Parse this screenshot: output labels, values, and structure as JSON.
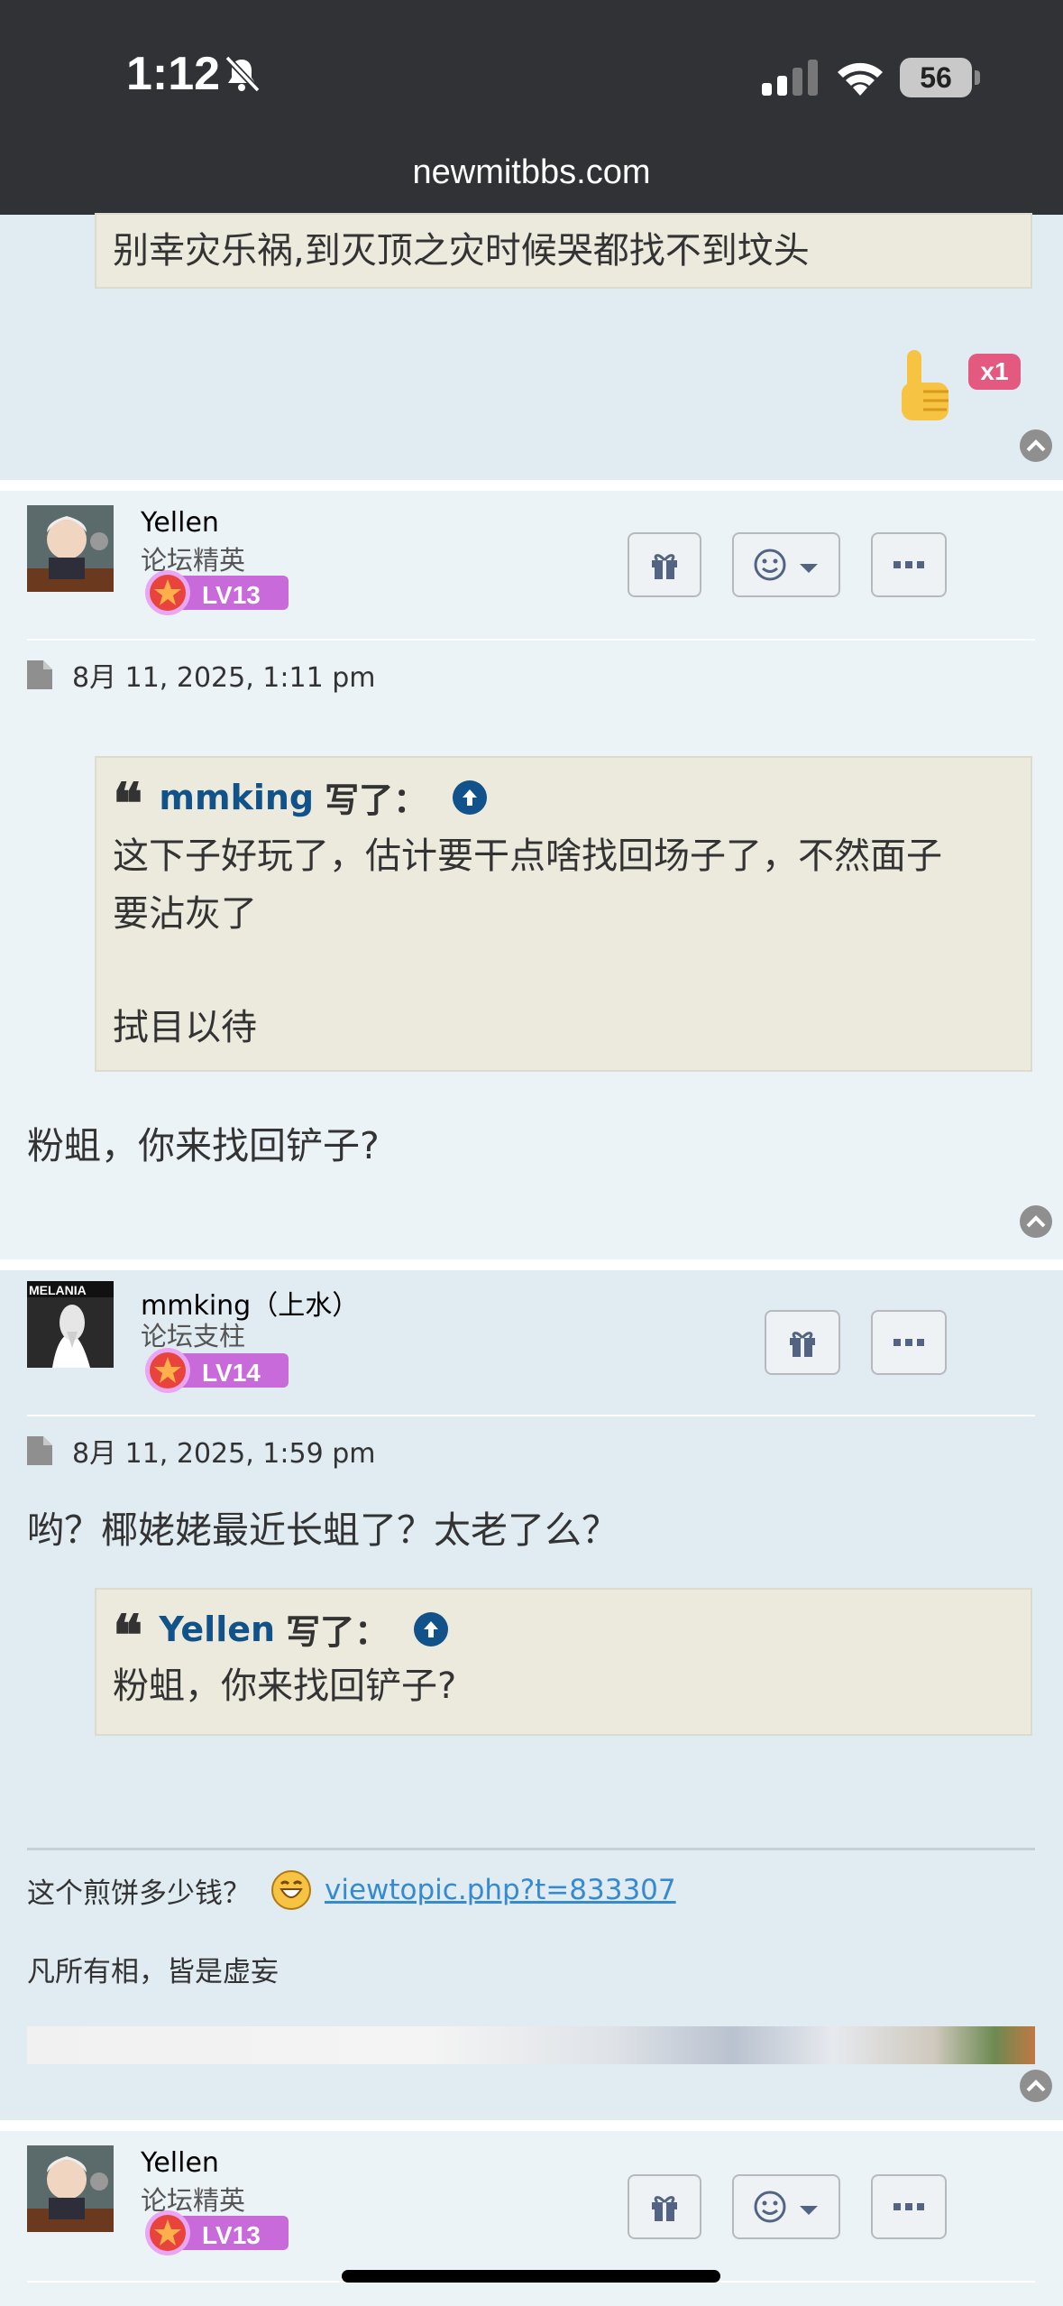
{
  "status": {
    "time": "1:12",
    "battery": "56"
  },
  "url": "newmitbbs.com",
  "prev_post": {
    "quote_text": "别幸灾乐祸,到灭顶之灾时候哭都找不到坟头",
    "like_count": "x1"
  },
  "posts": [
    {
      "author": "Yellen",
      "rank": "论坛精英",
      "level": "LV13",
      "date": "8月 11, 2025, 1:11 pm",
      "quote": {
        "author": "mmking",
        "wrote": "写了：",
        "lines": [
          "这下子好玩了，估计要干点啥找回场子了，不然面子",
          "要沾灰了",
          "",
          "拭目以待"
        ]
      },
      "body": "粉蛆，你来找回铲子?"
    },
    {
      "author": "mmking（上水）",
      "rank": "论坛支柱",
      "level": "LV14",
      "date": "8月 11, 2025, 1:59 pm",
      "body": "哟？椰姥姥最近长蛆了？太老了么？",
      "quote": {
        "author": "Yellen",
        "wrote": "写了：",
        "lines": [
          "粉蛆，你来找回铲子?"
        ]
      },
      "signature": {
        "line1_text": "这个煎饼多少钱？",
        "line1_link": "viewtopic.php?t=833307",
        "line2": "凡所有相，皆是虚妄"
      }
    },
    {
      "author": "Yellen",
      "rank": "论坛精英",
      "level": "LV13"
    }
  ],
  "icons": {
    "gift": "gift-icon",
    "reaction": "smiley-icon",
    "more": "more-icon",
    "file": "file-icon",
    "top": "back-to-top-icon"
  },
  "colors": {
    "quote_author": "#105289",
    "link": "#368ad2",
    "post_bg_a": "#e1ebf2",
    "post_bg_b": "#ecf3f7",
    "quote_bg": "#ebeadd"
  }
}
